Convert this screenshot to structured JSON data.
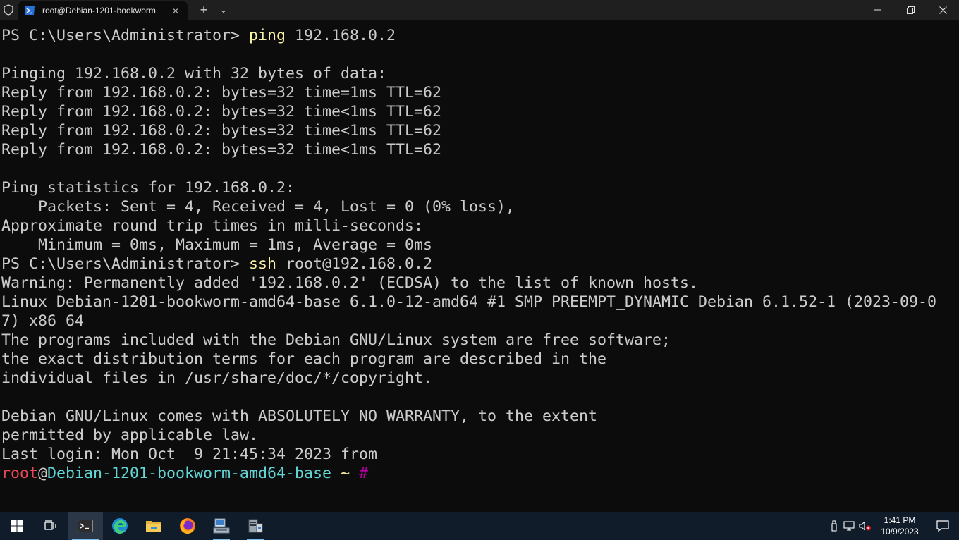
{
  "window": {
    "tab_title": "root@Debian-1201-bookworm",
    "tab_close": "×",
    "new_tab": "+",
    "dropdown": "⌄",
    "minimize": "—",
    "maximize": "❐",
    "close": "✕"
  },
  "terminal": {
    "lines": [
      {
        "type": "ps",
        "prompt": "PS C:\\Users\\Administrator> ",
        "cmd": "ping",
        "args": " 192.168.0.2"
      },
      {
        "type": "text",
        "text": ""
      },
      {
        "type": "text",
        "text": "Pinging 192.168.0.2 with 32 bytes of data:"
      },
      {
        "type": "text",
        "text": "Reply from 192.168.0.2: bytes=32 time=1ms TTL=62"
      },
      {
        "type": "text",
        "text": "Reply from 192.168.0.2: bytes=32 time<1ms TTL=62"
      },
      {
        "type": "text",
        "text": "Reply from 192.168.0.2: bytes=32 time<1ms TTL=62"
      },
      {
        "type": "text",
        "text": "Reply from 192.168.0.2: bytes=32 time<1ms TTL=62"
      },
      {
        "type": "text",
        "text": ""
      },
      {
        "type": "text",
        "text": "Ping statistics for 192.168.0.2:"
      },
      {
        "type": "text",
        "text": "    Packets: Sent = 4, Received = 4, Lost = 0 (0% loss),"
      },
      {
        "type": "text",
        "text": "Approximate round trip times in milli-seconds:"
      },
      {
        "type": "text",
        "text": "    Minimum = 0ms, Maximum = 1ms, Average = 0ms"
      },
      {
        "type": "ps",
        "prompt": "PS C:\\Users\\Administrator> ",
        "cmd": "ssh",
        "args": " root@192.168.0.2"
      },
      {
        "type": "text",
        "text": "Warning: Permanently added '192.168.0.2' (ECDSA) to the list of known hosts."
      },
      {
        "type": "text",
        "text": "Linux Debian-1201-bookworm-amd64-base 6.1.0-12-amd64 #1 SMP PREEMPT_DYNAMIC Debian 6.1.52-1 (2023-09-0"
      },
      {
        "type": "text",
        "text": "7) x86_64"
      },
      {
        "type": "text",
        "text": "The programs included with the Debian GNU/Linux system are free software;"
      },
      {
        "type": "text",
        "text": "the exact distribution terms for each program are described in the"
      },
      {
        "type": "text",
        "text": "individual files in /usr/share/doc/*/copyright."
      },
      {
        "type": "text",
        "text": ""
      },
      {
        "type": "text",
        "text": "Debian GNU/Linux comes with ABSOLUTELY NO WARRANTY, to the extent"
      },
      {
        "type": "text",
        "text": "permitted by applicable law."
      },
      {
        "type": "text",
        "text": "Last login: Mon Oct  9 21:45:34 2023 from"
      },
      {
        "type": "bash",
        "user": "root",
        "at": "@",
        "host": "Debian-1201-bookworm-amd64-base",
        "path": " ~ ",
        "hash": "#"
      }
    ]
  },
  "taskbar": {
    "time": "1:41 PM",
    "date": "10/9/2023",
    "apps": [
      "start-icon",
      "task-view-icon",
      "terminal-icon",
      "edge-icon",
      "file-explorer-icon",
      "firefox-icon",
      "network-app-icon",
      "server-manager-icon"
    ]
  },
  "colors": {
    "terminal_bg": "#0c0c0c",
    "terminal_fg": "#cccccc",
    "ps_command": "#f9f1a5",
    "bash_user": "#e74856",
    "bash_host": "#61d6d6",
    "bash_hash": "#b4009e",
    "taskbar_bg": "#101c2a"
  }
}
